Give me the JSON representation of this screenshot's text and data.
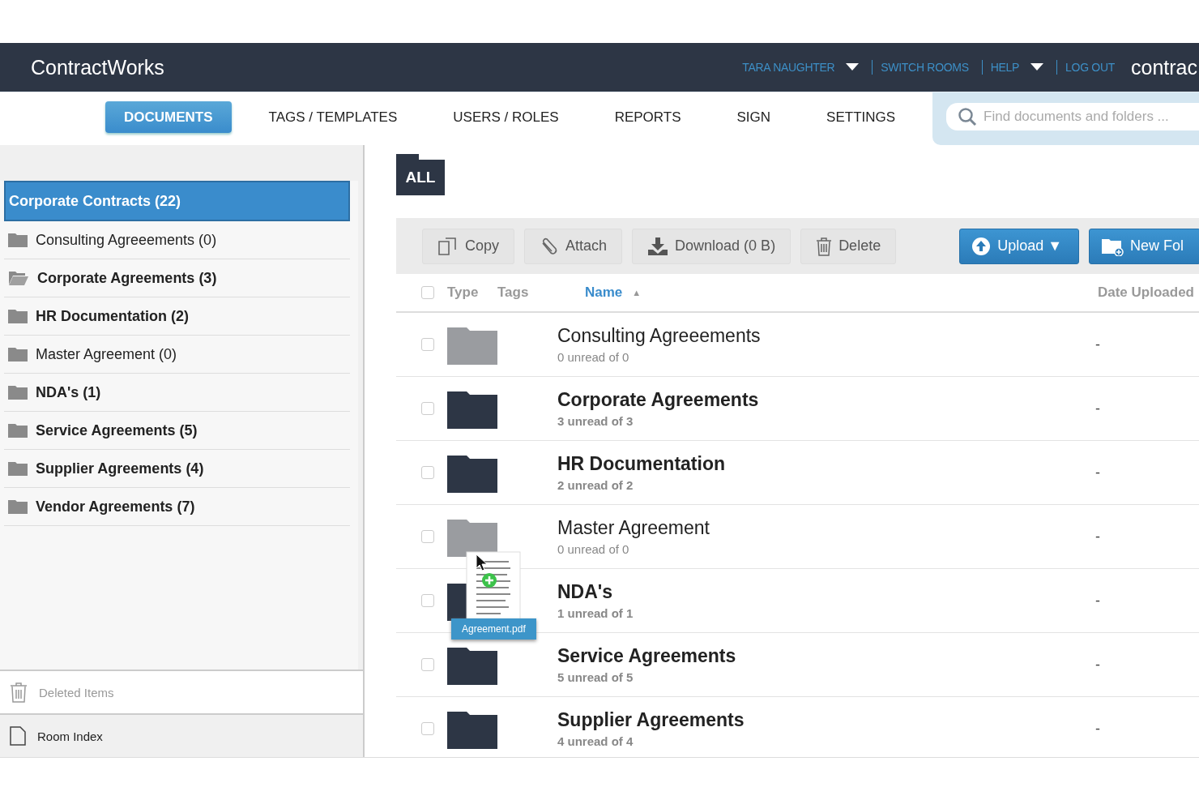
{
  "header": {
    "logo": "ContractWorks",
    "links": [
      {
        "label": "TARA NAUGHTER",
        "dropdown": true
      },
      {
        "label": "SWITCH ROOMS",
        "dropdown": false
      },
      {
        "label": "HELP",
        "dropdown": true
      },
      {
        "label": "LOG OUT",
        "dropdown": false
      }
    ],
    "brand": "contrac"
  },
  "tabs": [
    {
      "label": "DOCUMENTS",
      "selected": true
    },
    {
      "label": "TAGS / TEMPLATES",
      "selected": false
    },
    {
      "label": "USERS / ROLES",
      "selected": false
    },
    {
      "label": "REPORTS",
      "selected": false
    },
    {
      "label": "SIGN",
      "selected": false
    },
    {
      "label": "SETTINGS",
      "selected": false
    }
  ],
  "search": {
    "placeholder": "Find documents and folders ..."
  },
  "sidebar": {
    "items": [
      {
        "label": "Corporate Contracts (22)",
        "selected": true,
        "bold": true,
        "expanded": false
      },
      {
        "label": "Consulting Agreeements (0)",
        "selected": false,
        "bold": false,
        "expanded": false
      },
      {
        "label": "Corporate Agreements (3)",
        "selected": false,
        "bold": true,
        "expanded": true
      },
      {
        "label": "HR Documentation (2)",
        "selected": false,
        "bold": true,
        "expanded": false
      },
      {
        "label": "Master Agreement (0)",
        "selected": false,
        "bold": false,
        "expanded": false
      },
      {
        "label": "NDA's (1)",
        "selected": false,
        "bold": true,
        "expanded": false
      },
      {
        "label": "Service Agreements (5)",
        "selected": false,
        "bold": true,
        "expanded": false
      },
      {
        "label": "Supplier Agreements (4)",
        "selected": false,
        "bold": true,
        "expanded": false
      },
      {
        "label": "Vendor Agreements (7)",
        "selected": false,
        "bold": true,
        "expanded": false
      }
    ],
    "footer": [
      {
        "label": "Deleted Items",
        "kind": "trash"
      },
      {
        "label": "Room Index",
        "kind": "page"
      }
    ]
  },
  "breadcrumb": "ALL",
  "toolbar": [
    {
      "label": "Copy",
      "kind": "copy"
    },
    {
      "label": "Attach",
      "kind": "attach"
    },
    {
      "label": "Download (0 B)",
      "kind": "download"
    },
    {
      "label": "Delete",
      "kind": "delete"
    },
    {
      "label": "Upload ▼",
      "kind": "upload"
    },
    {
      "label": "New Fol",
      "kind": "newfolder"
    }
  ],
  "table": {
    "select_all": {
      "checked": false
    },
    "columns": [
      {
        "label": "Type",
        "sorted": false
      },
      {
        "label": "Tags",
        "sorted": false
      },
      {
        "label": "Name",
        "sorted": true,
        "sort_mark": "▲"
      },
      {
        "label": "Date Uploaded",
        "sorted": false
      }
    ],
    "rows": [
      {
        "name": "Consulting Agreeements",
        "sub": "0 unread of 0",
        "date": "-",
        "unread": false,
        "checked": false
      },
      {
        "name": "Corporate Agreements",
        "sub": "3 unread of 3",
        "date": "-",
        "unread": true,
        "checked": false
      },
      {
        "name": "HR Documentation",
        "sub": "2 unread of 2",
        "date": "-",
        "unread": true,
        "checked": false
      },
      {
        "name": "Master Agreement",
        "sub": "0 unread of 0",
        "date": "-",
        "unread": false,
        "checked": false
      },
      {
        "name": "NDA's",
        "sub": "1 unread of 1",
        "date": "-",
        "unread": true,
        "checked": false
      },
      {
        "name": "Service Agreements",
        "sub": "5 unread of 5",
        "date": "-",
        "unread": true,
        "checked": false
      },
      {
        "name": "Supplier Agreements",
        "sub": "4 unread of 4",
        "date": "-",
        "unread": true,
        "checked": false
      }
    ]
  },
  "drag": {
    "file": "Agreement.pdf"
  }
}
